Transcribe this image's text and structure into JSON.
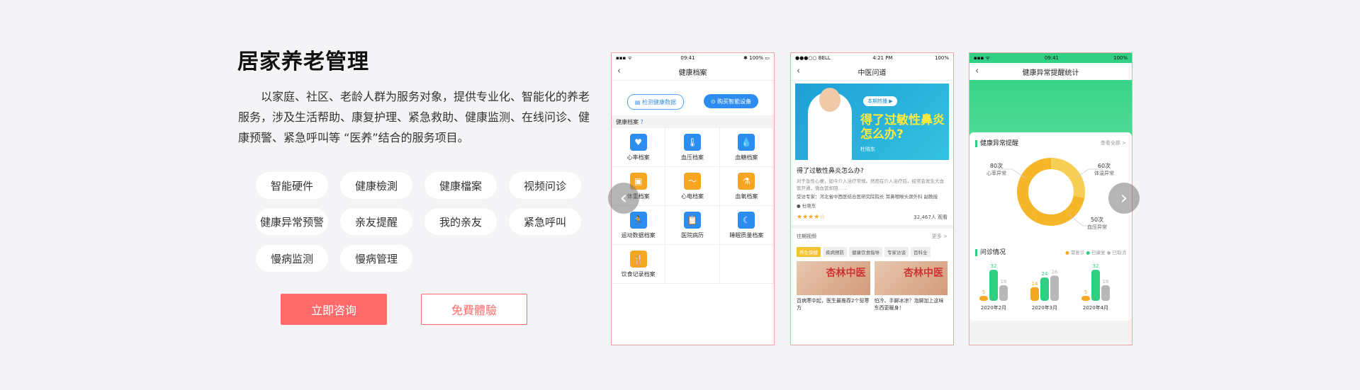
{
  "title": "居家养老管理",
  "description": "以家庭、社区、老龄人群为服务对象，提供专业化、智能化的养老服务，涉及生活帮助、康复护理、紧急救助、健康监测、在线问诊、健康预警、紧急呼叫等 “医养”结合的服务项目。",
  "tags": [
    "智能硬件",
    "健康檢測",
    "健康檔案",
    "视频问诊",
    "健康异常预警",
    "亲友提醒",
    "我的亲友",
    "紧急呼叫",
    "慢病监测",
    "慢病管理"
  ],
  "buttons": {
    "consult": "立即咨询",
    "trial": "免費體驗"
  },
  "phone1": {
    "time": "09:41",
    "battery": "100%",
    "title": "健康档案",
    "btn_check": "检测健康数据",
    "btn_buy": "购买智能设备",
    "section": "健康档案",
    "items": [
      {
        "label": "心率档案",
        "icon": "heart-icon",
        "color": "b"
      },
      {
        "label": "血压档案",
        "icon": "thermometer-icon",
        "color": "b"
      },
      {
        "label": "血糖档案",
        "icon": "drop-icon",
        "color": "b"
      },
      {
        "label": "体重档案",
        "icon": "scale-icon",
        "color": "y"
      },
      {
        "label": "心电档案",
        "icon": "ecg-icon",
        "color": "y"
      },
      {
        "label": "血氧档案",
        "icon": "flask-icon",
        "color": "y"
      },
      {
        "label": "运动数据档案",
        "icon": "run-icon",
        "color": "b"
      },
      {
        "label": "医院病历",
        "icon": "clipboard-icon",
        "color": "b"
      },
      {
        "label": "睡眠质量档案",
        "icon": "moon-icon",
        "color": "b"
      },
      {
        "label": "饮食记录档案",
        "icon": "fork-icon",
        "color": "y"
      }
    ]
  },
  "phone2": {
    "carrier": "●●●○○ BELL",
    "time": "4:21 PM",
    "battery": "100%",
    "title": "中医问道",
    "banner_tag": "本期热播",
    "banner_headline": "得了过敏性鼻炎 怎么办?",
    "banner_doctor": "杜晓东",
    "question": "得了过敏性鼻炎怎么办?",
    "question_text": "对于急性心梗，如今介入治疗常规。然而在介入治疗后，经常会发生大血管开通，微血管却阻……",
    "guest": "受访专家：河北省中西医结合医研究院院长 耳鼻咽喉头颈外科 副教授",
    "doctor": "杜晓东",
    "rating": 4,
    "views": "32,467人 观看",
    "past_label": "往期视频",
    "more": "更多 >",
    "tabs": [
      "养生保健",
      "疾病预防",
      "健康饮食指导",
      "专家访谈",
      "百科全"
    ],
    "videos": [
      {
        "calli": "杏林中医",
        "caption": "百病寒中起，医生最推荐2个驱寒方"
      },
      {
        "calli": "杏林中医",
        "caption": "怕冷、手脚冰凉？泡脚加上这味东西更暖身！"
      }
    ]
  },
  "phone3": {
    "time": "09:41",
    "battery": "100%",
    "title": "健康异常提醒统计",
    "alert_title": "健康异常提醒",
    "view_all": "查看全部 >",
    "donut": [
      {
        "value": "80次",
        "label": "心率异常"
      },
      {
        "value": "60次",
        "label": "体温异常"
      },
      {
        "value": "50次",
        "label": "血压异常"
      }
    ],
    "consult_title": "问诊情况",
    "legend": [
      "需复诊",
      "已康复",
      "已取消"
    ],
    "colors": {
      "pending": "#f5a623",
      "recovered": "#2fcf82",
      "cancelled": "#b8b8b8"
    }
  },
  "chart_data": {
    "type": "bar",
    "title": "问诊情况",
    "categories": [
      "2020年2月",
      "2020年3月",
      "2020年4月"
    ],
    "series": [
      {
        "name": "需复诊",
        "values": [
          5,
          14,
          5
        ]
      },
      {
        "name": "已康复",
        "values": [
          32,
          24,
          32
        ]
      },
      {
        "name": "已取消",
        "values": [
          16,
          26,
          16
        ]
      }
    ],
    "ylim": [
      0,
      35
    ]
  }
}
